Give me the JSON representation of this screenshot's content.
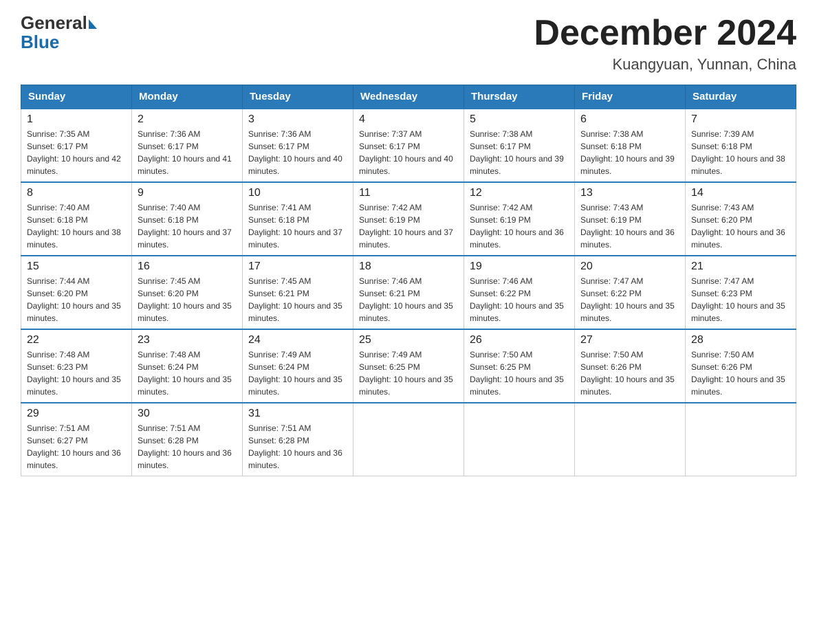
{
  "logo": {
    "general": "General",
    "blue": "Blue"
  },
  "title": "December 2024",
  "subtitle": "Kuangyuan, Yunnan, China",
  "days_of_week": [
    "Sunday",
    "Monday",
    "Tuesday",
    "Wednesday",
    "Thursday",
    "Friday",
    "Saturday"
  ],
  "weeks": [
    [
      {
        "day": "1",
        "sunrise": "7:35 AM",
        "sunset": "6:17 PM",
        "daylight": "10 hours and 42 minutes."
      },
      {
        "day": "2",
        "sunrise": "7:36 AM",
        "sunset": "6:17 PM",
        "daylight": "10 hours and 41 minutes."
      },
      {
        "day": "3",
        "sunrise": "7:36 AM",
        "sunset": "6:17 PM",
        "daylight": "10 hours and 40 minutes."
      },
      {
        "day": "4",
        "sunrise": "7:37 AM",
        "sunset": "6:17 PM",
        "daylight": "10 hours and 40 minutes."
      },
      {
        "day": "5",
        "sunrise": "7:38 AM",
        "sunset": "6:17 PM",
        "daylight": "10 hours and 39 minutes."
      },
      {
        "day": "6",
        "sunrise": "7:38 AM",
        "sunset": "6:18 PM",
        "daylight": "10 hours and 39 minutes."
      },
      {
        "day": "7",
        "sunrise": "7:39 AM",
        "sunset": "6:18 PM",
        "daylight": "10 hours and 38 minutes."
      }
    ],
    [
      {
        "day": "8",
        "sunrise": "7:40 AM",
        "sunset": "6:18 PM",
        "daylight": "10 hours and 38 minutes."
      },
      {
        "day": "9",
        "sunrise": "7:40 AM",
        "sunset": "6:18 PM",
        "daylight": "10 hours and 37 minutes."
      },
      {
        "day": "10",
        "sunrise": "7:41 AM",
        "sunset": "6:18 PM",
        "daylight": "10 hours and 37 minutes."
      },
      {
        "day": "11",
        "sunrise": "7:42 AM",
        "sunset": "6:19 PM",
        "daylight": "10 hours and 37 minutes."
      },
      {
        "day": "12",
        "sunrise": "7:42 AM",
        "sunset": "6:19 PM",
        "daylight": "10 hours and 36 minutes."
      },
      {
        "day": "13",
        "sunrise": "7:43 AM",
        "sunset": "6:19 PM",
        "daylight": "10 hours and 36 minutes."
      },
      {
        "day": "14",
        "sunrise": "7:43 AM",
        "sunset": "6:20 PM",
        "daylight": "10 hours and 36 minutes."
      }
    ],
    [
      {
        "day": "15",
        "sunrise": "7:44 AM",
        "sunset": "6:20 PM",
        "daylight": "10 hours and 35 minutes."
      },
      {
        "day": "16",
        "sunrise": "7:45 AM",
        "sunset": "6:20 PM",
        "daylight": "10 hours and 35 minutes."
      },
      {
        "day": "17",
        "sunrise": "7:45 AM",
        "sunset": "6:21 PM",
        "daylight": "10 hours and 35 minutes."
      },
      {
        "day": "18",
        "sunrise": "7:46 AM",
        "sunset": "6:21 PM",
        "daylight": "10 hours and 35 minutes."
      },
      {
        "day": "19",
        "sunrise": "7:46 AM",
        "sunset": "6:22 PM",
        "daylight": "10 hours and 35 minutes."
      },
      {
        "day": "20",
        "sunrise": "7:47 AM",
        "sunset": "6:22 PM",
        "daylight": "10 hours and 35 minutes."
      },
      {
        "day": "21",
        "sunrise": "7:47 AM",
        "sunset": "6:23 PM",
        "daylight": "10 hours and 35 minutes."
      }
    ],
    [
      {
        "day": "22",
        "sunrise": "7:48 AM",
        "sunset": "6:23 PM",
        "daylight": "10 hours and 35 minutes."
      },
      {
        "day": "23",
        "sunrise": "7:48 AM",
        "sunset": "6:24 PM",
        "daylight": "10 hours and 35 minutes."
      },
      {
        "day": "24",
        "sunrise": "7:49 AM",
        "sunset": "6:24 PM",
        "daylight": "10 hours and 35 minutes."
      },
      {
        "day": "25",
        "sunrise": "7:49 AM",
        "sunset": "6:25 PM",
        "daylight": "10 hours and 35 minutes."
      },
      {
        "day": "26",
        "sunrise": "7:50 AM",
        "sunset": "6:25 PM",
        "daylight": "10 hours and 35 minutes."
      },
      {
        "day": "27",
        "sunrise": "7:50 AM",
        "sunset": "6:26 PM",
        "daylight": "10 hours and 35 minutes."
      },
      {
        "day": "28",
        "sunrise": "7:50 AM",
        "sunset": "6:26 PM",
        "daylight": "10 hours and 35 minutes."
      }
    ],
    [
      {
        "day": "29",
        "sunrise": "7:51 AM",
        "sunset": "6:27 PM",
        "daylight": "10 hours and 36 minutes."
      },
      {
        "day": "30",
        "sunrise": "7:51 AM",
        "sunset": "6:28 PM",
        "daylight": "10 hours and 36 minutes."
      },
      {
        "day": "31",
        "sunrise": "7:51 AM",
        "sunset": "6:28 PM",
        "daylight": "10 hours and 36 minutes."
      },
      null,
      null,
      null,
      null
    ]
  ]
}
